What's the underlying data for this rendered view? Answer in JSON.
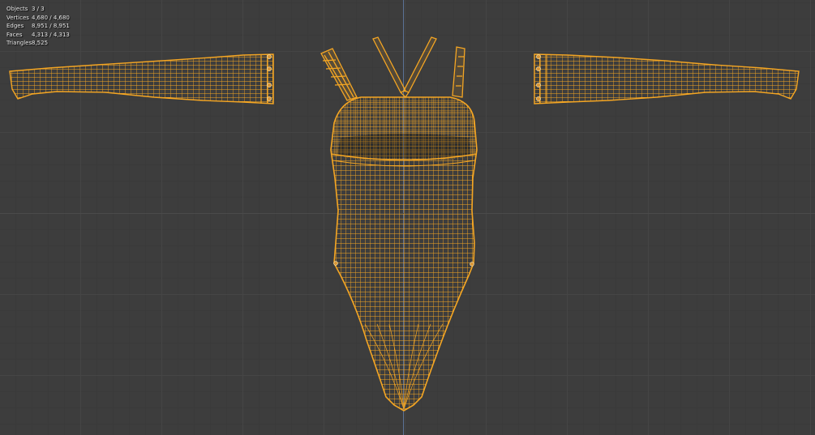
{
  "stats": {
    "objects": {
      "label": "Objects",
      "value": "3 / 3"
    },
    "vertices": {
      "label": "Vertices",
      "value": "4,680 / 4,680"
    },
    "edges": {
      "label": "Edges",
      "value": "8,951 / 8,951"
    },
    "faces": {
      "label": "Faces",
      "value": "4,313 / 4,313"
    },
    "triangles": {
      "label": "Triangles",
      "value": "8,525"
    }
  },
  "colors": {
    "background": "#3d3d3d",
    "wire_selected": "#f5a623",
    "wire_dark": "#c77f1a",
    "axis_y": "#5b7296"
  },
  "icons": [
    "stats-overlay"
  ]
}
